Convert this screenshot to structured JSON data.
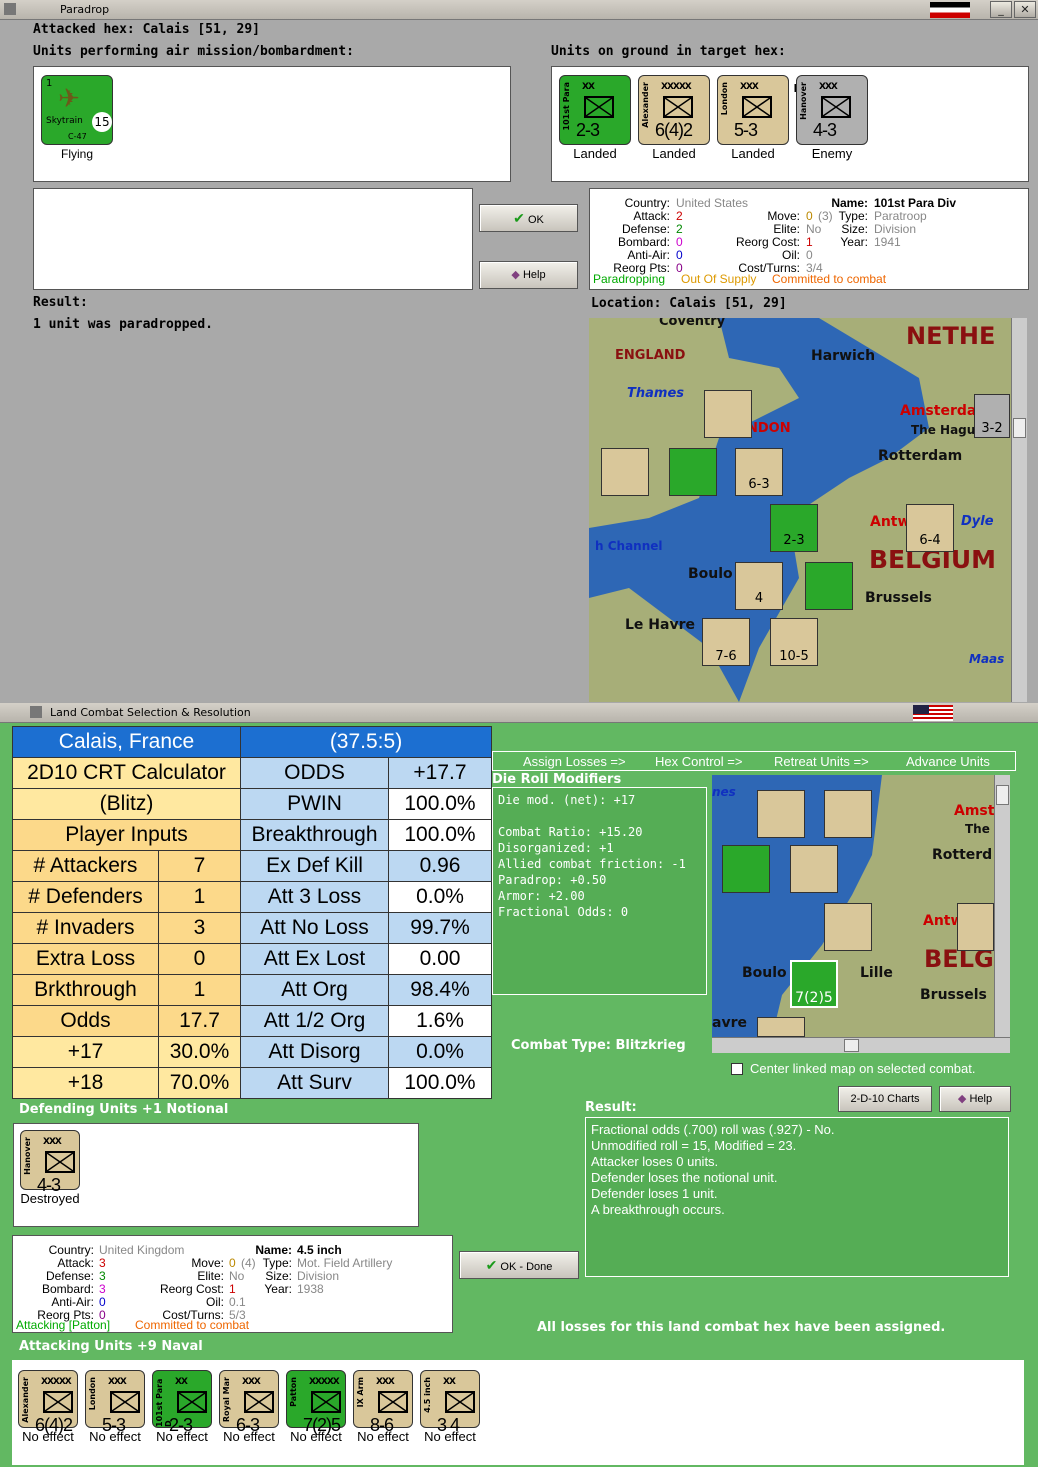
{
  "top_window": {
    "title": "Paradrop",
    "attacked_hex": "Attacked hex: Calais  [51, 29]",
    "air_units_label": "Units performing air mission/bombardment:",
    "ground_units_label": "Units on ground in target hex:",
    "result_label": "Result:",
    "result_text": "1 unit was paradropped.",
    "location_label": "Location:  Calais  [51, 29]",
    "ok_label": "OK",
    "help_label": "Help"
  },
  "air_units": [
    {
      "name": "Skytrain",
      "type": "C-47",
      "value": "15",
      "status": "Flying",
      "top": "1"
    }
  ],
  "ground_units": [
    {
      "name": "101st Para",
      "size": "XX",
      "value": "2-3",
      "status": "Landed",
      "color": "#2aa82a"
    },
    {
      "name": "Alexander",
      "size": "XXXXX",
      "value": "6(4)2",
      "status": "Landed",
      "color": "#d9c79a"
    },
    {
      "name": "London",
      "size": "XXX",
      "value": "5-3",
      "status": "Landed",
      "color": "#d9c79a",
      "extra": "R"
    },
    {
      "name": "Hanover",
      "size": "XXX",
      "value": "4-3",
      "status": "Enemy",
      "color": "#b0b0b0"
    }
  ],
  "unit_info_top": {
    "country_label": "Country:",
    "country": "United States",
    "attack_label": "Attack:",
    "attack": "2",
    "defense_label": "Defense:",
    "defense": "2",
    "bombard_label": "Bombard:",
    "bombard": "0",
    "antiair_label": "Anti-Air:",
    "antiair": "0",
    "reorg_label": "Reorg Pts:",
    "reorg": "0",
    "move_label": "Move:",
    "move": "0",
    "move_paren": "(3)",
    "elite_label": "Elite:",
    "elite": "No",
    "reorgcost_label": "Reorg Cost:",
    "reorgcost": "1",
    "oil_label": "Oil:",
    "oil": "0",
    "cost_label": "Cost/Turns:",
    "cost": "3/4",
    "name_label": "Name:",
    "name": "101st Para Div",
    "type_label": "Type:",
    "type": "Paratroop",
    "size_label": "Size:",
    "size": "Division",
    "year_label": "Year:",
    "year": "1941",
    "status1": "Paradropping",
    "status2": "Out Of Supply",
    "status3": "Committed to combat"
  },
  "map_top_labels": {
    "netherlands": "NETHE",
    "england": "ENGLAND",
    "harwich": "Harwich",
    "thames": "Thames",
    "amsterdam": "Amsterda",
    "hague": "The Hague",
    "london": "NDON",
    "rotterdam": "Rotterdam",
    "antwerp": "Antw",
    "dyle": "Dyle",
    "belgium": "BELGIUM",
    "channel": "h Channel",
    "boulogne": "Boulo",
    "brussels": "Brussels",
    "lehavre": "Le Havre",
    "maas": "Maas",
    "coventry": "Coventry"
  },
  "map_top_units": [
    {
      "v": "3-2"
    },
    {
      "v": "6-3"
    },
    {
      "v": "2-3"
    },
    {
      "v": "6-4"
    },
    {
      "v": "4"
    },
    {
      "v": "7-6"
    },
    {
      "v": "10-5"
    }
  ],
  "bottom_window": {
    "title": "Land Combat Selection & Resolution",
    "tabs": [
      "Assign Losses =>",
      "Hex Control =>",
      "Retreat Units =>",
      "Advance Units"
    ],
    "dierolls_label": "Die Roll Modifiers",
    "dierolls": [
      "Die mod. (net): +17",
      "",
      "Combat Ratio: +15.20",
      "Disorganized: +1",
      "Allied combat friction: -1",
      "Paradrop: +0.50",
      "Armor: +2.00",
      "Fractional Odds: 0"
    ],
    "combat_type": "Combat Type:  Blitzkrieg",
    "center_map": "Center linked map on selected combat.",
    "charts_btn": "2-D-10 Charts",
    "help_btn": "Help",
    "result_label": "Result:",
    "result_lines": [
      "Fractional odds (.700) roll was (.927)  - No.",
      "Unmodified roll = 15, Modified = 23.",
      "Attacker loses 0 units.",
      "Defender loses the notional unit.",
      "Defender loses 1 unit.",
      "A breakthrough occurs."
    ],
    "defending_label": "Defending Units +1 Notional",
    "ok_done": "OK - Done",
    "all_losses": "All losses for this land combat hex have been assigned.",
    "attacking_label": "Attacking Units +9 Naval"
  },
  "crt": {
    "title": "Calais, France",
    "ratio": "(37.5:5)",
    "calc1": "2D10 CRT Calculator",
    "calc2": "(Blitz)",
    "player_inputs": "Player Inputs",
    "left": [
      [
        "# Attackers",
        "7"
      ],
      [
        "# Defenders",
        "1"
      ],
      [
        "# Invaders",
        "3"
      ],
      [
        "Extra Loss",
        "0"
      ],
      [
        "Brkthrough",
        "1"
      ],
      [
        "Odds",
        "17.7"
      ],
      [
        "+17",
        "30.0%"
      ],
      [
        "+18",
        "70.0%"
      ]
    ],
    "right": [
      [
        "ODDS",
        "+17.7"
      ],
      [
        "PWIN",
        "100.0%"
      ],
      [
        "Breakthrough",
        "100.0%"
      ],
      [
        "Ex Def Kill",
        "0.96"
      ],
      [
        "Att 3 Loss",
        "0.0%"
      ],
      [
        "Att No Loss",
        "99.7%"
      ],
      [
        "Att Ex Lost",
        "0.00"
      ],
      [
        "Att Org",
        "98.4%"
      ],
      [
        "Att 1/2 Org",
        "1.6%"
      ],
      [
        "Att Disorg",
        "0.0%"
      ],
      [
        "Att Surv",
        "100.0%"
      ]
    ]
  },
  "defender": {
    "name": "Hanover",
    "size": "XXX",
    "value": "4-3",
    "status": "Destroyed"
  },
  "unit_info_bottom": {
    "country_label": "Country:",
    "country": "United Kingdom",
    "attack_label": "Attack:",
    "attack": "3",
    "defense_label": "Defense:",
    "defense": "3",
    "bombard_label": "Bombard:",
    "bombard": "3",
    "antiair_label": "Anti-Air:",
    "antiair": "0",
    "reorg_label": "Reorg Pts:",
    "reorg": "0",
    "move_label": "Move:",
    "move": "0",
    "move_paren": "(4)",
    "elite_label": "Elite:",
    "elite": "No",
    "reorgcost_label": "Reorg Cost:",
    "reorgcost": "1",
    "oil_label": "Oil:",
    "oil": "0.1",
    "cost_label": "Cost/Turns:",
    "cost": "5/3",
    "name_label": "Name:",
    "name": "4.5 inch",
    "type_label": "Type:",
    "type": "Mot. Field Artillery",
    "size_label": "Size:",
    "size": "Division",
    "year_label": "Year:",
    "year": "1938",
    "status1": "Attacking [Patton]",
    "status2": "Committed to combat"
  },
  "attackers": [
    {
      "name": "Alexander",
      "size": "XXXXX",
      "value": "6(4)2",
      "status": "No effect",
      "color": "#d9c79a"
    },
    {
      "name": "London",
      "size": "XXX",
      "value": "5-3",
      "status": "No effect",
      "color": "#d9c79a"
    },
    {
      "name": "101st Para D",
      "size": "XX",
      "value": "2-3",
      "status": "No effect",
      "color": "#2aa82a"
    },
    {
      "name": "Royal Mar",
      "size": "XXX",
      "value": "6-3",
      "status": "No effect",
      "color": "#d9c79a"
    },
    {
      "name": "Patton",
      "size": "XXXXX",
      "value": "7(2)5",
      "status": "No effect",
      "color": "#2aa82a"
    },
    {
      "name": "IX Arm",
      "size": "XXX",
      "value": "8-6",
      "status": "No effect",
      "color": "#d9c79a"
    },
    {
      "name": "4.5 inch",
      "size": "XX",
      "value": "3 4",
      "status": "No effect",
      "color": "#d9c79a"
    }
  ],
  "map_bottom_labels": {
    "amst": "Amst",
    "the": "The",
    "rotterd": "Rotterd",
    "antw": "Antw",
    "boulo": "Boulo",
    "lille": "Lille",
    "belg": "BELG",
    "brussels": "Brussels",
    "havre": "avre",
    "nes": "nes",
    "val": "7(2)5"
  },
  "colors": {
    "green_panel": "#5fb85f",
    "crt_blue": "#1c6fd1",
    "crt_light": "#ffe8a0",
    "crt_yellow": "#fcd98a"
  }
}
